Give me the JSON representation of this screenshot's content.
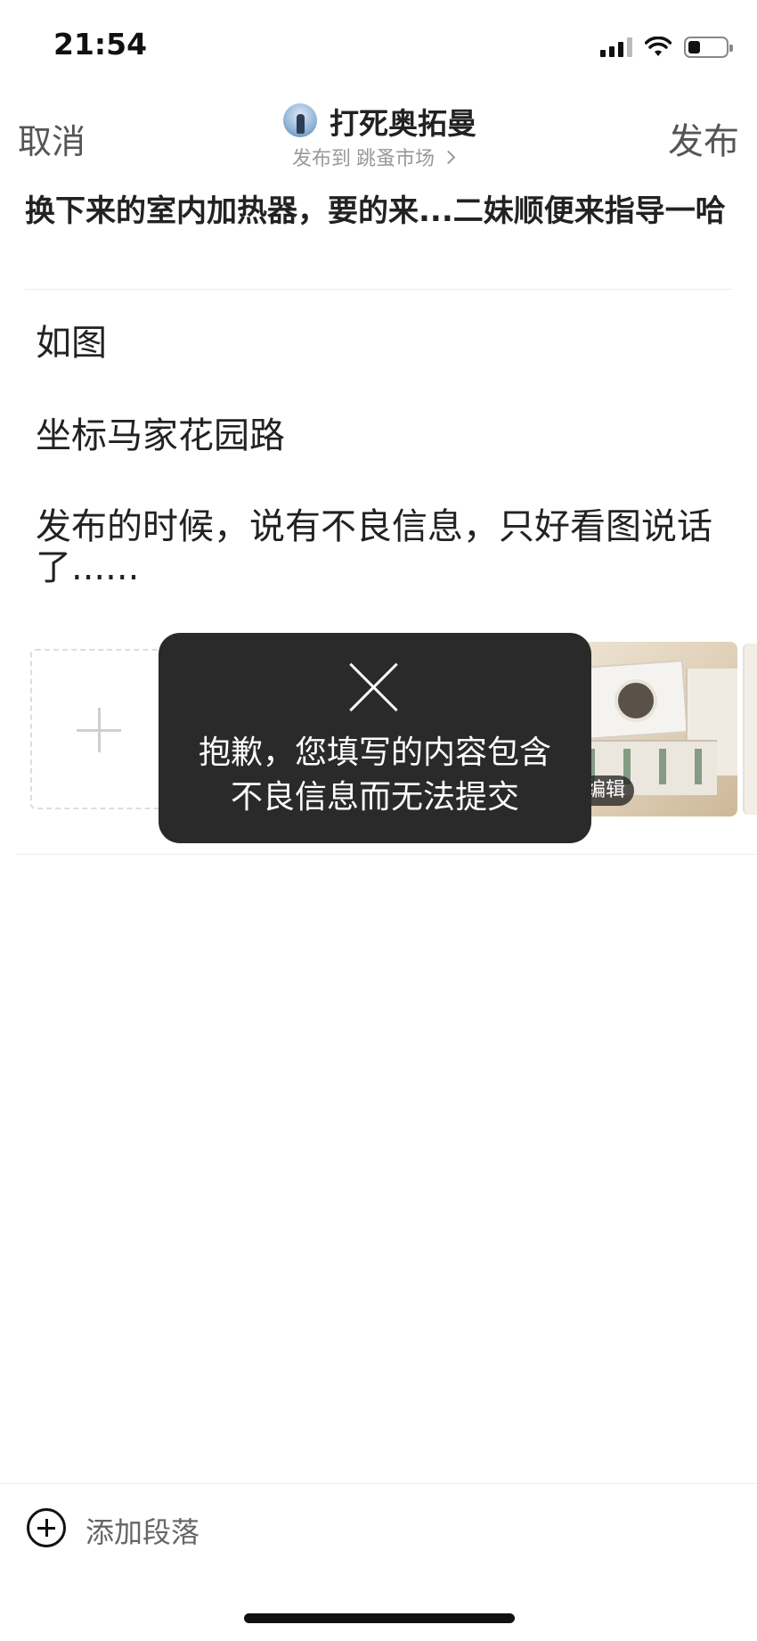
{
  "status_bar": {
    "time": "21:54",
    "icons": [
      "signal-icon",
      "wifi-icon",
      "battery-icon"
    ]
  },
  "nav": {
    "cancel_label": "取消",
    "publish_label": "发布",
    "user_name": "打死奥拓曼",
    "publish_prefix": "发布到",
    "publish_target": "跳蚤市场"
  },
  "post": {
    "title": "换下来的室内加热器，要的来...二妹顺便来指导一哈",
    "paragraphs": [
      "如图",
      "坐标马家花园路",
      "发布的时候，说有不良信息，只好看图说话了......"
    ]
  },
  "media": {
    "edit_label": "编辑"
  },
  "toast": {
    "line1": "抱歉，您填写的内容包含",
    "line2": "不良信息而无法提交"
  },
  "bottom": {
    "add_paragraph_label": "添加段落"
  },
  "colors": {
    "toast_bg": "#2a2a2a",
    "text": "#222222",
    "muted": "#999999"
  }
}
